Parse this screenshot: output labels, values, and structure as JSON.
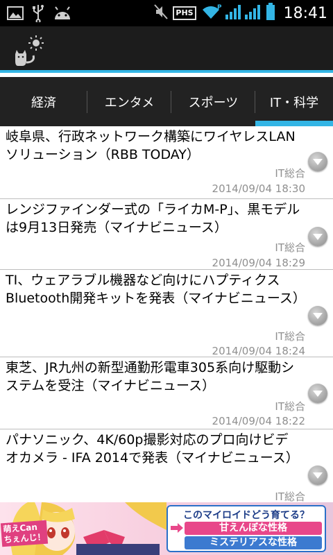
{
  "status_bar": {
    "time": "18:41",
    "carrier_badge": "PHS",
    "icons": [
      "image-icon",
      "usb-icon",
      "android-icon",
      "mute-icon",
      "wifi-icon",
      "signal-icon",
      "battery-icon"
    ]
  },
  "action_bar": {
    "logo_icon": "cat-sun-logo-icon"
  },
  "tabs": [
    {
      "label": "経済",
      "active": false
    },
    {
      "label": "エンタメ",
      "active": false
    },
    {
      "label": "スポーツ",
      "active": false
    },
    {
      "label": "IT・科学",
      "active": true
    }
  ],
  "news": [
    {
      "title": "岐阜県、行政ネットワーク構築にワイヤレスLANソリューション（RBB TODAY）",
      "category": "IT総合",
      "date": "2014/09/04 18:30"
    },
    {
      "title": "レンジファインダー式の「ライカM-P」、黒モデルは9月13日発売（マイナビニュース）",
      "category": "IT総合",
      "date": "2014/09/04 18:29"
    },
    {
      "title": "TI、ウェアラブル機器など向けにハプティクスBluetooth開発キットを発表（マイナビニュース）",
      "category": "IT総合",
      "date": "2014/09/04 18:24"
    },
    {
      "title": "東芝、JR九州の新型通勤形電車305系向け駆動システムを受注（マイナビニュース）",
      "category": "IT総合",
      "date": "2014/09/04 18:22"
    },
    {
      "title": "パナソニック、4K/60p撮影対応のプロ向けビデオカメラ - IFA 2014で発表（マイナビニュース）",
      "category": "IT総合",
      "date": ""
    }
  ],
  "ad": {
    "logo_text_line1": "萌えCan",
    "logo_text_line2": "ちぇんじ！",
    "question": "このマイロイドどう育てる？",
    "option1": "甘えんぼな性格",
    "option2": "ミステリアスな性格"
  },
  "colors": {
    "accent": "#33b5e5",
    "tab_bg": "#222222",
    "action_bar_bg": "#1c1c1c",
    "meta_text": "#8f8f8f"
  }
}
